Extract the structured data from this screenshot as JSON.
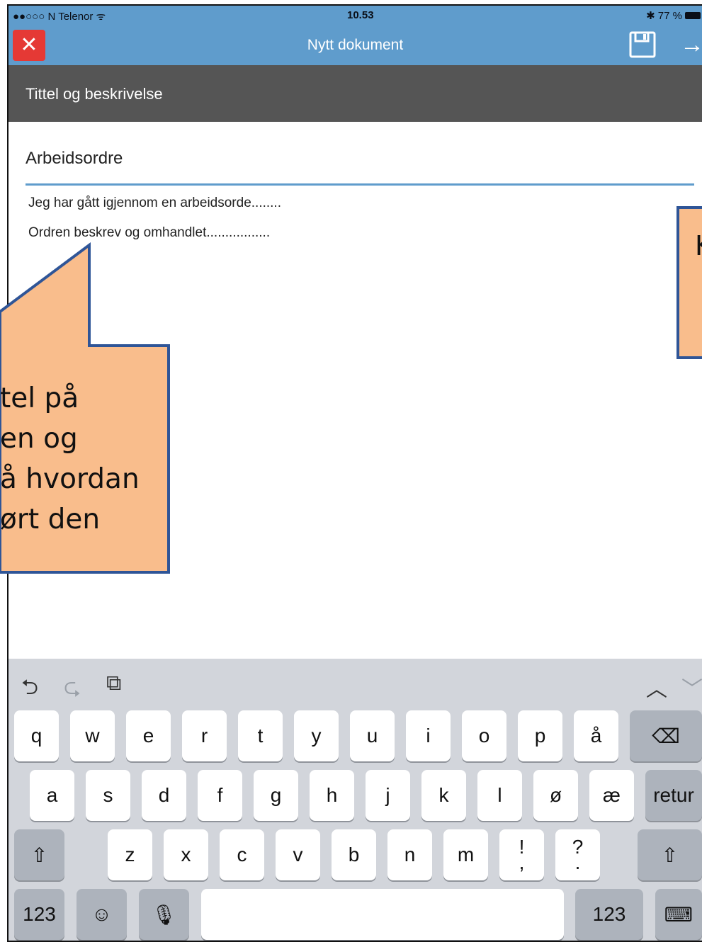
{
  "status_bar": {
    "carrier": "●●○○○ N Telenor ᯤ",
    "time": "10.53",
    "battery": "✱ 77 %"
  },
  "navbar": {
    "title": "Nytt dokument"
  },
  "section": {
    "header": "Tittel og beskrivelse"
  },
  "document": {
    "title_value": "Arbeidsordre",
    "description_lines": [
      "Jeg har gått igjennom en arbeidsorde........",
      "Ordren beskrev og omhandlet................."
    ]
  },
  "callout_left": {
    "lines": [
      "tel på",
      "en og",
      "å hvordan",
      "ørt den"
    ]
  },
  "callout_right": {
    "text": "K"
  },
  "keyboard": {
    "row1": [
      "q",
      "w",
      "e",
      "r",
      "t",
      "y",
      "u",
      "i",
      "o",
      "p",
      "å"
    ],
    "row2": [
      "a",
      "s",
      "d",
      "f",
      "g",
      "h",
      "j",
      "k",
      "l",
      "ø",
      "æ"
    ],
    "row3": [
      "z",
      "x",
      "c",
      "v",
      "b",
      "n",
      "m"
    ],
    "punct_1": {
      "top": "!",
      "bottom": ","
    },
    "punct_2": {
      "top": "?",
      "bottom": "."
    },
    "return_label": "retur",
    "numbers_label": "123",
    "numbers_label_right": "123"
  },
  "colors": {
    "accent": "#5f9ccc",
    "close": "#e53935",
    "header": "#555555",
    "callout_fill": "#f9bd8c",
    "callout_border": "#2f5597"
  }
}
